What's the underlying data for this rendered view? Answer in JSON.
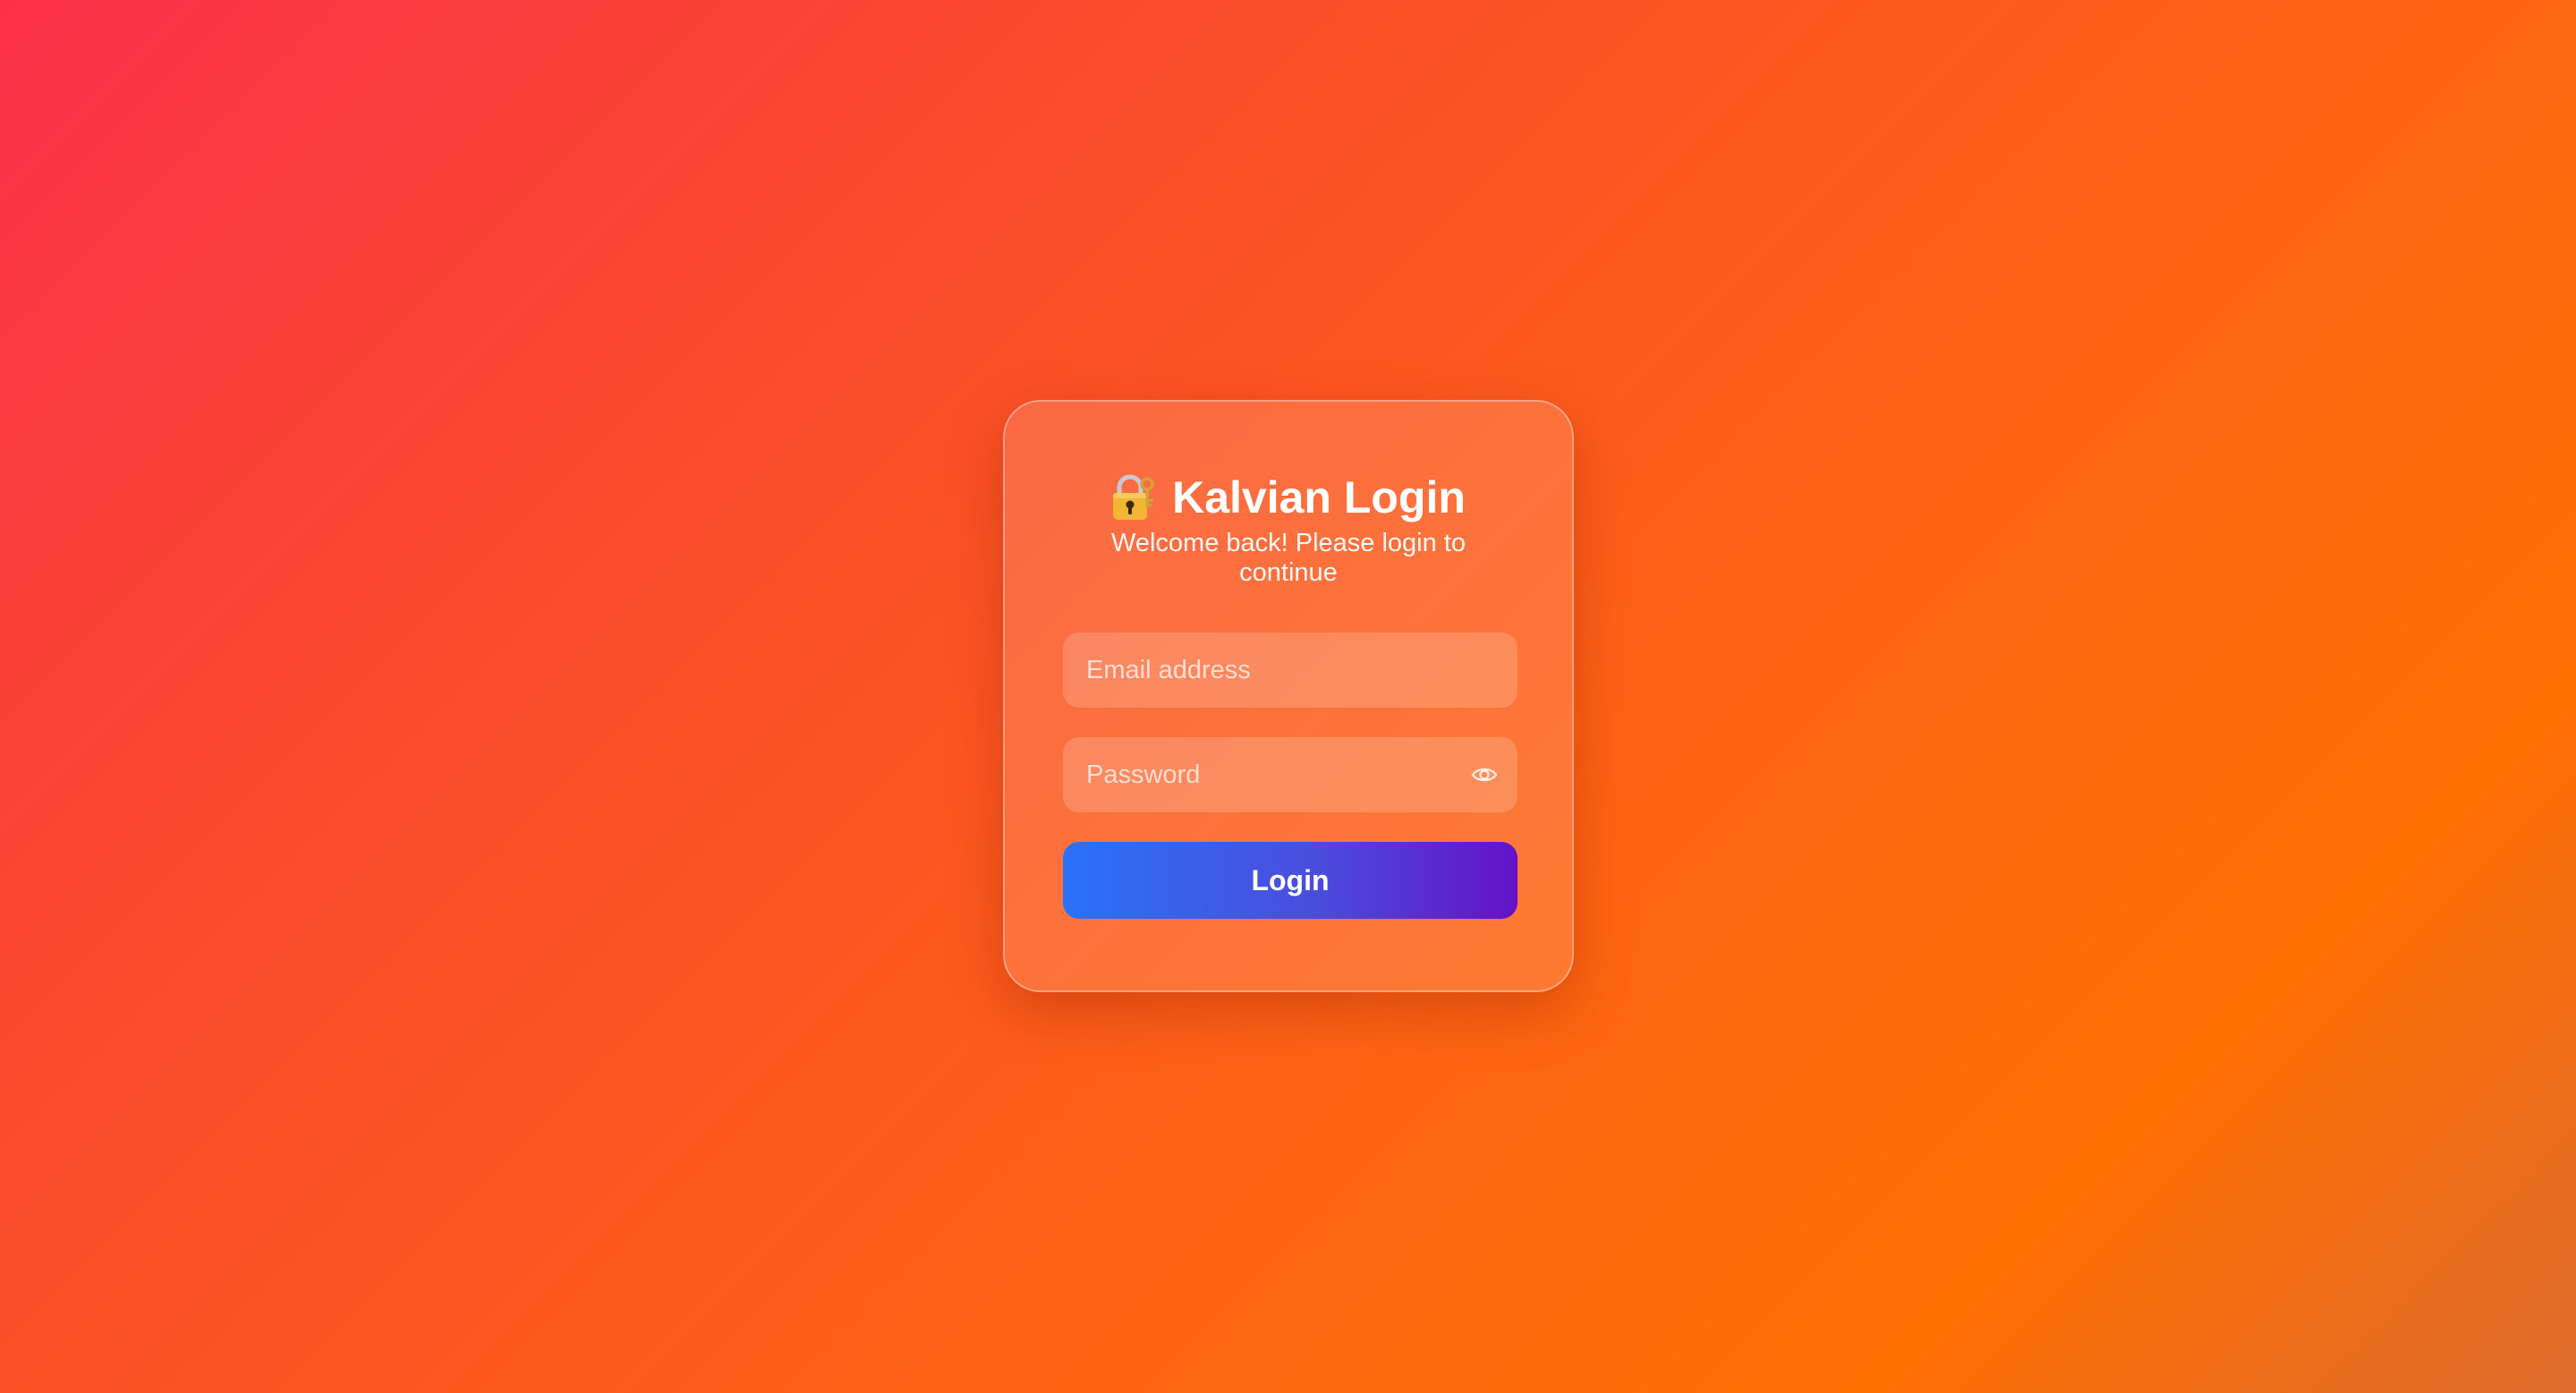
{
  "login_card": {
    "icon": "locked-with-key-icon",
    "title": "Kalvian Login",
    "subtitle": "Welcome back! Please login to continue",
    "email_field": {
      "placeholder": "Email address",
      "value": ""
    },
    "password_field": {
      "placeholder": "Password",
      "value": "",
      "toggle_icon": "eye-icon"
    },
    "login_button_label": "Login"
  },
  "colors": {
    "background_start": "#fb314a",
    "background_end": "#ff6f03",
    "button_start": "#2a72f8",
    "button_end": "#6412c8",
    "text": "#ffffff"
  }
}
